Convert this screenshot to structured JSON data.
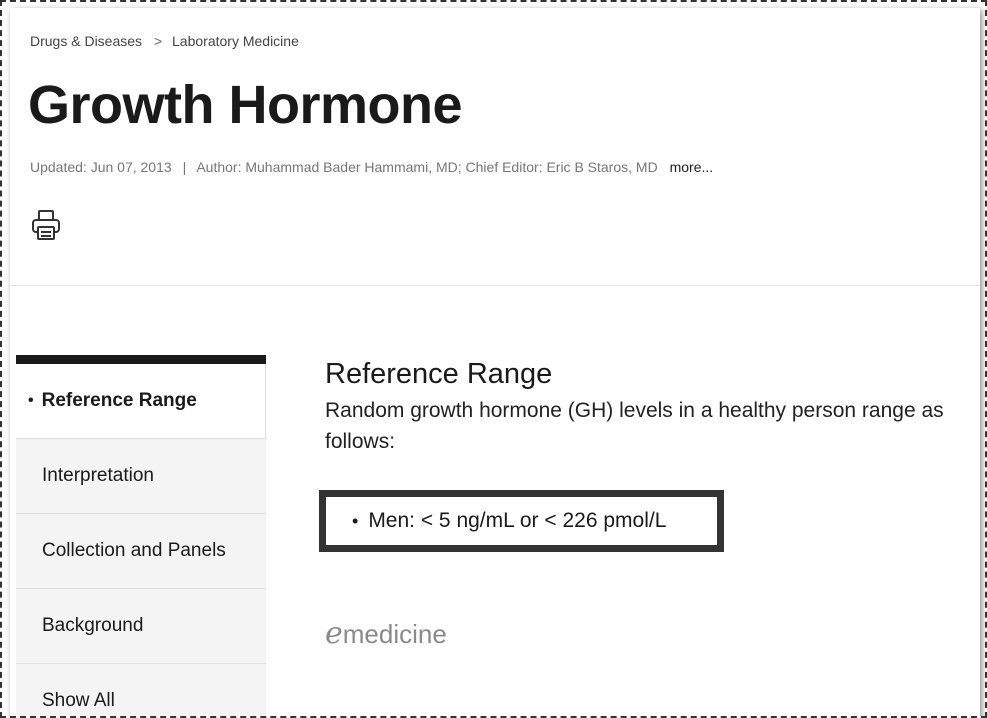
{
  "breadcrumb": {
    "items": [
      "Drugs & Diseases",
      "Laboratory Medicine"
    ],
    "separator": ">"
  },
  "article": {
    "title": "Growth Hormone",
    "updated": "Updated: Jun 07, 2013",
    "divider": "|",
    "authors": "Author: Muhammad Bader Hammami, MD; Chief Editor: Eric B Staros, MD",
    "more_label": "more..."
  },
  "icons": {
    "print": "printer-icon"
  },
  "sidebar": {
    "items": [
      {
        "label": "Reference Range",
        "active": true
      },
      {
        "label": "Interpretation",
        "active": false
      },
      {
        "label": "Collection and Panels",
        "active": false
      },
      {
        "label": "Background",
        "active": false
      },
      {
        "label": "Show All",
        "active": false
      }
    ]
  },
  "section": {
    "title": "Reference Range",
    "intro": "Random growth hormone (GH) levels in a healthy person range as follows:",
    "bullet": "•",
    "list_items": [
      "Men: < 5 ng/mL or < 226 pmol/L"
    ]
  },
  "brand": {
    "logo_e": "e",
    "logo_word": "medicine"
  },
  "colors": {
    "text_dark": "#1a1a1a",
    "text_muted": "#777777",
    "highlight_border": "#333333",
    "sidebar_bg": "#f4f4f4"
  }
}
